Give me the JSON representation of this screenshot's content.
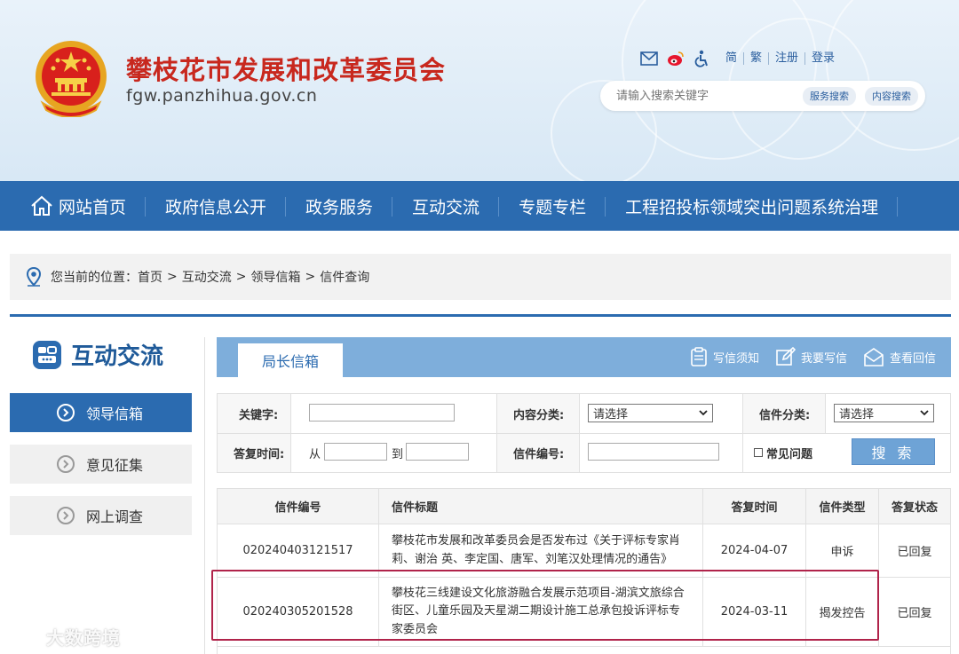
{
  "header": {
    "site_title": "攀枝花市发展和改革委员会",
    "domain": "fgw.panzhihua.gov.cn",
    "top_links": [
      "简",
      "繁",
      "注册",
      "登录"
    ],
    "top_icons": [
      "mail-icon",
      "weibo-icon",
      "accessibility-icon"
    ],
    "search_placeholder": "请输入搜索关键字",
    "search_buttons": [
      "服务搜索",
      "内容搜索"
    ],
    "colors": {
      "title": "#c8281e",
      "nav": "#2b6bb0"
    }
  },
  "nav": {
    "items": [
      "网站首页",
      "政府信息公开",
      "政务服务",
      "互动交流",
      "专题专栏",
      "工程招投标领域突出问题系统治理"
    ]
  },
  "breadcrumb": {
    "label": "您当前的位置：",
    "items": [
      "首页",
      "互动交流",
      "领导信箱",
      "信件查询"
    ],
    "sep": ">"
  },
  "sidebar": {
    "title": "互动交流",
    "items": [
      {
        "label": "领导信箱",
        "active": true
      },
      {
        "label": "意见征集",
        "active": false
      },
      {
        "label": "网上调查",
        "active": false
      }
    ]
  },
  "tabbar": {
    "active_tab": "局长信箱",
    "actions": [
      "写信须知",
      "我要写信",
      "查看回信"
    ]
  },
  "form": {
    "keyword_label": "关键字:",
    "content_type_label": "内容分类:",
    "content_type_value": "请选择",
    "letter_type_label": "信件分类:",
    "letter_type_value": "请选择",
    "reply_time_label": "答复时间:",
    "from_label": "从",
    "to_label": "到",
    "letter_no_label": "信件编号:",
    "faq_label": "常见问题",
    "search_button": "搜 索"
  },
  "table": {
    "headers": [
      "信件编号",
      "信件标题",
      "答复时间",
      "信件类型",
      "答复状态"
    ],
    "rows": [
      {
        "id": "020240403121517",
        "title": "攀枝花市发展和改革委员会是否发布过《关于评标专家肖莉、谢治 英、李定国、唐军、刘笔汉处理情况的通告》",
        "date": "2024-04-07",
        "type": "申诉",
        "status": "已回复"
      },
      {
        "id": "020240305201528",
        "title": "攀枝花三线建设文化旅游融合发展示范项目-湖滨文旅综合街区、儿童乐园及天星湖二期设计施工总承包投诉评标专家委员会",
        "date": "2024-03-11",
        "type": "揭发控告",
        "status": "已回复"
      }
    ]
  },
  "watermark": "大数跨境"
}
